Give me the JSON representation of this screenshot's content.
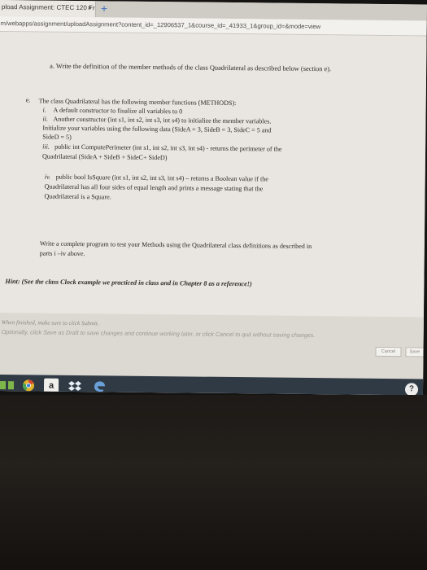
{
  "browser": {
    "tab_title": "pload Assignment: CTEC 120 Fr",
    "tab_close": "×",
    "new_tab": "+",
    "url": "m/webapps/assignment/uploadAssignment?content_id=_12906537_1&course_id=_41933_1&group_id=&mode=view"
  },
  "question": {
    "a_line": "a. Write the definition of the member methods of the class Quadrilateral as described below (section e).",
    "section_letter": "e.",
    "intro": "The class Quadrilateral has the following member functions (METHODS):",
    "items": [
      {
        "num": "i.",
        "lines": [
          "A default constructor to finalize all variables to 0"
        ]
      },
      {
        "num": "ii.",
        "lines": [
          "Another constructor (int s1, int s2, int s3, int s4) to initialize the member variables.",
          "Initialize your variables using the following data (SideA = 3, SideB = 3, SideC = 5 and",
          "SideD = 5)"
        ]
      },
      {
        "num": "iii.",
        "lines": [
          "public int ComputePerimeter (int s1, int s2, int s3, int s4) - returns the perimeter of the",
          "Quadrilateral (SideA + SideB + SideC+ SideD)"
        ]
      },
      {
        "num": "iv.",
        "lines": [
          "public bool IsSquare (int s1, int s2, int s3, int s4) – returns a Boolean value if the",
          "Quadrilateral has all four sides of equal length and prints a message stating that the",
          "Quadrilateral is a Square."
        ]
      }
    ],
    "write_lines": [
      "Write a complete program to test your Methods using the Quadrilateral class definitions as described in",
      "parts i –iv above."
    ],
    "hint": "Hint: (See the class Clock example we practiced in class and in Chapter 8 as a reference!)"
  },
  "footer": {
    "finish_line1": "When finished, make sure to click Submit.",
    "finish_line2": "Optionally, click Save as Draft to save changes and continue working later, or click Cancel to quit without saving changes.",
    "cancel_label": "Cancel",
    "save_label": "Save"
  },
  "taskbar": {
    "app_letter": "a",
    "help_glyph": "?"
  },
  "colors": {
    "page_bg": "#e9e6e1",
    "taskbar_bg": "#2f3a45",
    "link_blue": "#3f6fbd"
  }
}
